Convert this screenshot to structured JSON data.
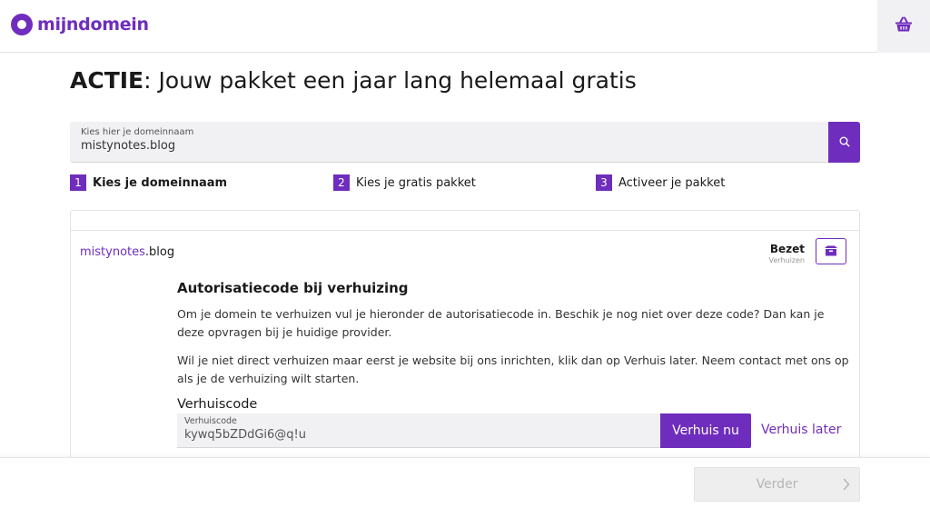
{
  "header": {
    "logo_text": "mijndomein",
    "basket_icon": "basket-icon"
  },
  "title": {
    "strong": "ACTIE",
    "rest": ": Jouw pakket een jaar lang helemaal gratis"
  },
  "search": {
    "label": "Kies hier je domeinnaam",
    "value": "mistynotes.blog",
    "icon": "search-icon"
  },
  "steps": [
    {
      "num": "1",
      "label": "Kies je domeinnaam"
    },
    {
      "num": "2",
      "label": "Kies je gratis pakket"
    },
    {
      "num": "3",
      "label": "Activeer je pakket"
    }
  ],
  "result": {
    "domain_name": "mistynotes",
    "domain_ext": ".blog",
    "status_title": "Bezet",
    "status_sub": "Verhuizen",
    "status_icon": "box-icon"
  },
  "transfer": {
    "title": "Autorisatiecode bij verhuizing",
    "para1": "Om je domein te verhuizen vul je hieronder de autorisatiecode in. Beschik je nog niet over deze code? Dan kan je deze opvragen bij je huidige provider.",
    "para2": "Wil je niet direct verhuizen maar eerst je website bij ons inrichten, klik dan op Verhuis later. Neem contact met ons op als je de verhuizing wilt starten.",
    "code_title": "Verhuiscode",
    "code_label": "Verhuiscode",
    "code_value": "kywq5bZDdGi6@q!u",
    "move_now": "Verhuis nu",
    "move_later": "Verhuis later"
  },
  "footer": {
    "next_label": "Verder"
  },
  "colors": {
    "brand": "#6f2dbd",
    "field_bg": "#f1f1f3",
    "disabled_bg": "#eeeeee"
  }
}
